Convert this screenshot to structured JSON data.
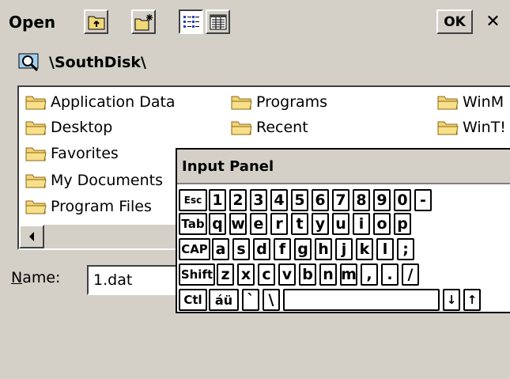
{
  "dialog": {
    "title": "Open",
    "ok_label": "OK",
    "close_label": "✕"
  },
  "toolbar": {
    "icons": [
      "up-folder-icon",
      "new-folder-icon",
      "list-view-icon",
      "details-view-icon"
    ],
    "selected_view": "list"
  },
  "path": {
    "text": "\\SouthDisk\\"
  },
  "files": {
    "col1": [
      "Application Data",
      "Desktop",
      "Favorites",
      "My Documents",
      "Program Files"
    ],
    "col2": [
      "Programs",
      "Recent"
    ],
    "col3": [
      "WinM",
      "WinT!"
    ]
  },
  "name_field": {
    "label": "Name:",
    "value": "1.dat"
  },
  "input_panel": {
    "title": "Input Panel",
    "rows": [
      [
        "Esc",
        "1",
        "2",
        "3",
        "4",
        "5",
        "6",
        "7",
        "8",
        "9",
        "0",
        "-"
      ],
      [
        "Tab",
        "q",
        "w",
        "e",
        "r",
        "t",
        "y",
        "u",
        "i",
        "o",
        "p"
      ],
      [
        "CAP",
        "a",
        "s",
        "d",
        "f",
        "g",
        "h",
        "j",
        "k",
        "l",
        ";"
      ],
      [
        "Shift",
        "z",
        "x",
        "c",
        "v",
        "b",
        "n",
        "m",
        ",",
        ".",
        "/"
      ],
      [
        "Ctl",
        "áü",
        "`",
        "\\",
        "",
        "↓",
        "↑"
      ]
    ]
  }
}
